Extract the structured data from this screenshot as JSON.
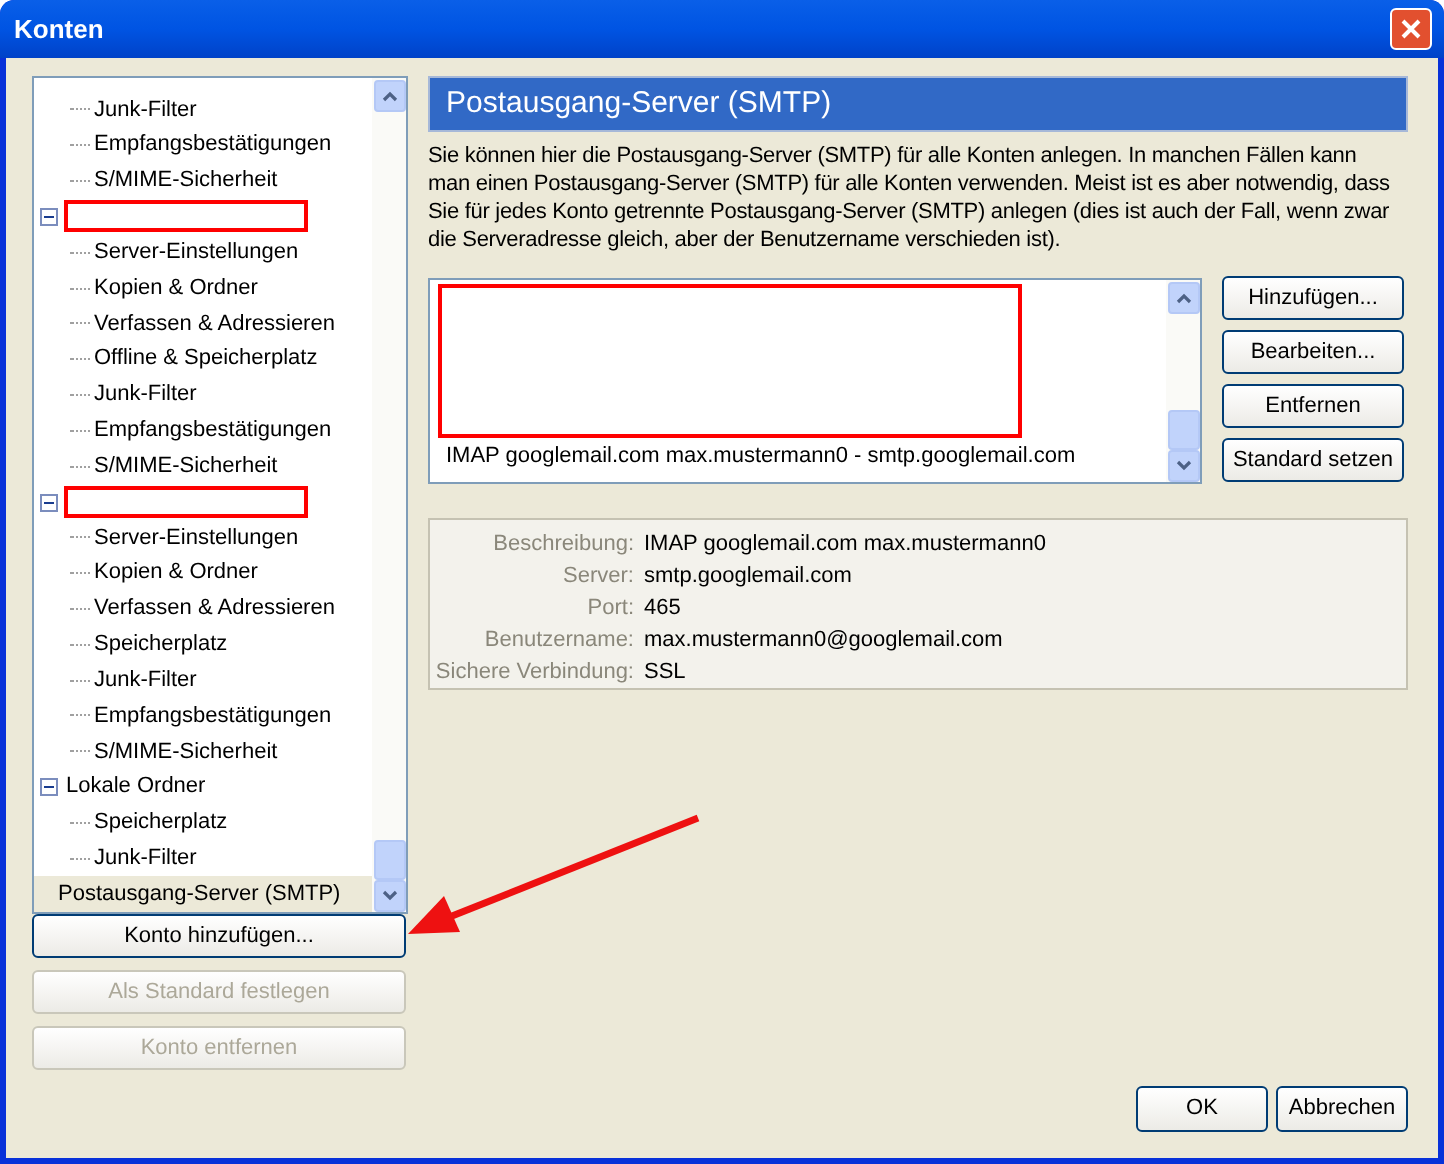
{
  "window": {
    "title": "Konten"
  },
  "tree": {
    "items": [
      {
        "kind": "leaf",
        "label": "Junk-Filter",
        "selected": false
      },
      {
        "kind": "leaf",
        "label": "Empfangsbestätigungen",
        "selected": false
      },
      {
        "kind": "leaf",
        "label": "S/MIME-Sicherheit",
        "selected": false
      },
      {
        "kind": "group",
        "redacted": true,
        "expanded": true,
        "selected": false,
        "children": [
          {
            "kind": "leaf",
            "label": "Server-Einstellungen",
            "selected": false
          },
          {
            "kind": "leaf",
            "label": "Kopien & Ordner",
            "selected": false
          },
          {
            "kind": "leaf",
            "label": "Verfassen & Adressieren",
            "selected": false
          },
          {
            "kind": "leaf",
            "label": "Offline & Speicherplatz",
            "selected": false
          },
          {
            "kind": "leaf",
            "label": "Junk-Filter",
            "selected": false
          },
          {
            "kind": "leaf",
            "label": "Empfangsbestätigungen",
            "selected": false
          },
          {
            "kind": "leaf",
            "label": "S/MIME-Sicherheit",
            "selected": false
          }
        ]
      },
      {
        "kind": "group",
        "redacted": true,
        "expanded": true,
        "selected": false,
        "children": [
          {
            "kind": "leaf",
            "label": "Server-Einstellungen",
            "selected": false
          },
          {
            "kind": "leaf",
            "label": "Kopien & Ordner",
            "selected": false
          },
          {
            "kind": "leaf",
            "label": "Verfassen & Adressieren",
            "selected": false
          },
          {
            "kind": "leaf",
            "label": "Speicherplatz",
            "selected": false
          },
          {
            "kind": "leaf",
            "label": "Junk-Filter",
            "selected": false
          },
          {
            "kind": "leaf",
            "label": "Empfangsbestätigungen",
            "selected": false
          },
          {
            "kind": "leaf",
            "label": "S/MIME-Sicherheit",
            "selected": false
          }
        ]
      },
      {
        "kind": "group",
        "label": "Lokale Ordner",
        "expanded": true,
        "selected": false,
        "children": [
          {
            "kind": "leaf",
            "label": "Speicherplatz",
            "selected": false
          },
          {
            "kind": "leaf",
            "label": "Junk-Filter",
            "selected": false
          }
        ]
      },
      {
        "kind": "page",
        "label": "Postausgang-Server (SMTP)",
        "selected": true
      }
    ]
  },
  "left_buttons": [
    {
      "label": "Konto hinzufügen...",
      "disabled": false
    },
    {
      "label": "Als Standard festlegen",
      "disabled": true
    },
    {
      "label": "Konto entfernen",
      "disabled": true
    }
  ],
  "panel": {
    "title": "Postausgang-Server (SMTP)",
    "description": "Sie können hier die Postausgang-Server (SMTP) für alle Konten anlegen. In manchen Fällen kann man einen Postausgang-Server (SMTP) für alle Konten verwenden. Meist ist es aber notwendig, dass Sie für jedes Konto getrennte Postausgang-Server (SMTP) anlegen (dies ist auch der Fall, wenn zwar die Serveradresse gleich, aber der Benutzername verschieden ist).",
    "servers": [
      {
        "redacted": true,
        "selected": false
      },
      {
        "label": "IMAP googlemail.com max.mustermann0 - smtp.googlemail.com",
        "selected": false
      }
    ],
    "buttons": [
      {
        "label": "Hinzufügen..."
      },
      {
        "label": "Bearbeiten..."
      },
      {
        "label": "Entfernen"
      },
      {
        "label": "Standard setzen"
      }
    ],
    "details": [
      {
        "label": "Beschreibung:",
        "value": "IMAP googlemail.com max.mustermann0"
      },
      {
        "label": "Server:",
        "value": "smtp.googlemail.com"
      },
      {
        "label": "Port:",
        "value": "465"
      },
      {
        "label": "Benutzername:",
        "value": "max.mustermann0@googlemail.com"
      },
      {
        "label": "Sichere Verbindung:",
        "value": "SSL"
      }
    ]
  },
  "footer_buttons": [
    {
      "label": "OK"
    },
    {
      "label": "Abbrechen"
    }
  ]
}
